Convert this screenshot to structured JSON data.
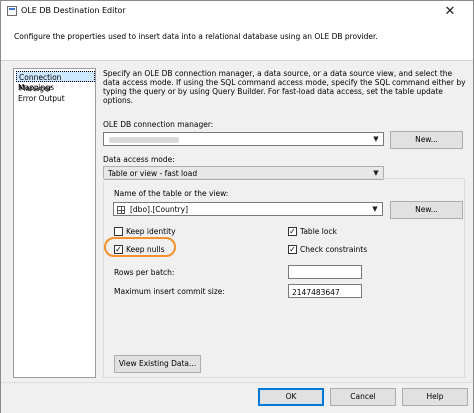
{
  "window": {
    "title": "OLE DB Destination Editor",
    "close_glyph": "✕"
  },
  "header": {
    "text": "Configure the properties used to insert data into a relational database using an OLE DB provider."
  },
  "nav": {
    "items": [
      {
        "label": "Connection Manager",
        "selected": true
      },
      {
        "label": "Mappings",
        "selected": false
      },
      {
        "label": "Error Output",
        "selected": false
      }
    ]
  },
  "main": {
    "description": "Specify an OLE DB connection manager, a data source, or a data source view, and select the data access mode. If using the SQL command access mode, specify the SQL command either by typing the query or by using Query Builder. For fast-load data access, set the table update options.",
    "connection_manager_label": "OLE DB connection manager:",
    "connection_new_label": "New...",
    "data_access_mode_label": "Data access mode:",
    "data_access_mode_value": "Table or view - fast load",
    "table_name_label": "Name of the table or the view:",
    "table_name_value": "[dbo].[Country]",
    "table_new_label": "New...",
    "options": {
      "keep_identity_label": "Keep identity",
      "keep_identity_checked": false,
      "table_lock_label": "Table lock",
      "table_lock_checked": true,
      "keep_nulls_label": "Keep nulls",
      "keep_nulls_checked": true,
      "check_constraints_label": "Check constraints",
      "check_constraints_checked": true,
      "check_glyph": "✓"
    },
    "rows_per_batch_label": "Rows per batch:",
    "rows_per_batch_value": "",
    "max_insert_commit_label": "Maximum insert commit size:",
    "max_insert_commit_value": "2147483647",
    "view_existing_label": "View Existing Data...",
    "arrow_glyph": "▼"
  },
  "footer": {
    "ok_label": "OK",
    "cancel_label": "Cancel",
    "help_label": "Help"
  },
  "colors": {
    "highlight": "#f5922f",
    "selection": "#cde8ff",
    "primary_border": "#0078d7"
  }
}
